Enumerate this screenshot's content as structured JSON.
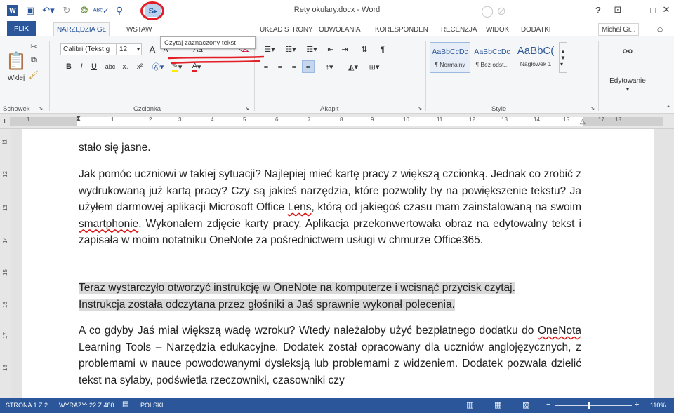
{
  "window": {
    "title": "Rety okulary.docx - Word",
    "help": "?",
    "minimize": "—",
    "restore": "□",
    "close": "✕"
  },
  "tabs": [
    "PLIK",
    "NARZĘDZIA GŁ",
    "WSTAW",
    "UKŁAD STRONY",
    "ODWOŁANIA",
    "KORESPONDEN",
    "RECENZJA",
    "WIDOK",
    "DODATKI"
  ],
  "user": "Michał Gr...",
  "tooltip": "Czytaj zaznaczony tekst",
  "clipboard": {
    "paste": "Wklej",
    "label": "Schowek"
  },
  "font": {
    "family": "Calibri (Tekst g",
    "size": "12",
    "label": "Czcionka",
    "bold": "B",
    "italic": "I",
    "underline": "U",
    "strike": "abc",
    "sub": "x₂",
    "sup": "x²",
    "grow": "A",
    "shrink": "A",
    "case": "Aa"
  },
  "paragraph": {
    "label": "Akapit"
  },
  "styles": {
    "label": "Style",
    "items": [
      {
        "sample": "AaBbCcDc",
        "name": "¶ Normalny"
      },
      {
        "sample": "AaBbCcDc",
        "name": "¶ Bez odst..."
      },
      {
        "sample": "AaBbC(",
        "name": "Nagłówek 1"
      }
    ]
  },
  "editing": {
    "label": "Edytowanie"
  },
  "ruler": [
    "1",
    "1",
    "2",
    "3",
    "4",
    "5",
    "6",
    "7",
    "8",
    "9",
    "10",
    "11",
    "12",
    "13",
    "14",
    "15",
    "17",
    "18"
  ],
  "vruler": [
    "11",
    "12",
    "13",
    "14",
    "15",
    "16",
    "17",
    "18"
  ],
  "doc": {
    "p0": "stało się jasne.",
    "p1_a": "Jak pomóc uczniowi w takiej sytuacji? Najlepiej mieć kartę pracy z większą czcionką. Jednak co zrobić z wydrukowaną już kartą pracy? Czy są jakieś narzędzia, które pozwoliły by na powiększenie tekstu? Ja użyłem darmowej aplikacji Microsoft Office ",
    "p1_lens": "Lens",
    "p1_b": ", którą od jakiegoś czasu mam zainstalowaną na swoim ",
    "p1_smart": "smartphonie",
    "p1_c": ". Wykonałem zdjęcie karty pracy. Aplikacja przekonwertowała obraz na edytowalny tekst i zapisała w moim notatniku OneNote za pośrednictwem usługi w chmurze Office365.",
    "p2_a": "Teraz wystarczyło otworzyć instrukcję w OneNote na komputerze i wcisnąć przycisk czytaj.",
    "p2_b": "Instrukcja została odczytana przez głośniki a Jaś sprawnie wykonał polecenia.",
    "p3_a": "A co gdyby Jaś miał większą wadę wzroku? Wtedy należałoby użyć bezpłatnego dodatku do ",
    "p3_onenota": "OneNota",
    "p3_b": " Learning Tools – Narzędzia edukacyjne. Dodatek został opracowany dla uczniów anglojęzycznych, z problemami w nauce powodowanymi dysleksją lub problemami z widzeniem. Dodatek pozwala dzielić tekst na sylaby, podświetla rzeczowniki, czasowniki czy"
  },
  "status": {
    "page": "STRONA 1 Z 2",
    "words": "WYRAZY: 22 Z 480",
    "lang": "POLSKI",
    "zoom": "110%",
    "zoom_minus": "−",
    "zoom_plus": "+"
  },
  "colors": {
    "accent": "#2b579a",
    "highlight": "#d9d9d9",
    "annotation": "#e41e26"
  }
}
